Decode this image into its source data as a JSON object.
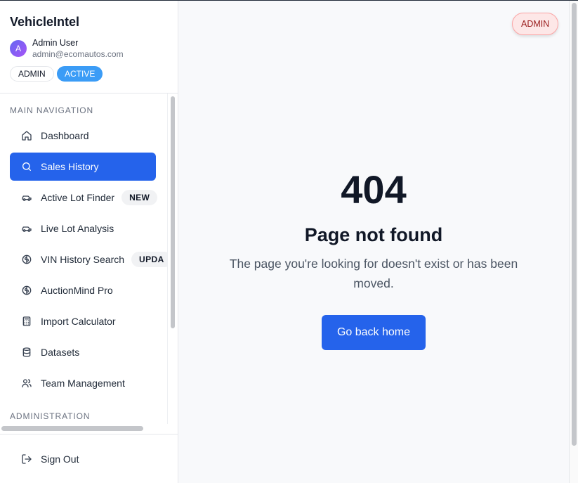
{
  "app": {
    "name": "VehicleIntel"
  },
  "user": {
    "initial": "A",
    "name": "Admin User",
    "email": "admin@ecomautos.com",
    "role_badge": "ADMIN",
    "status_badge": "ACTIVE"
  },
  "nav": {
    "section_main": "MAIN NAVIGATION",
    "section_admin": "ADMINISTRATION",
    "items": [
      {
        "label": "Dashboard",
        "icon": "home-icon"
      },
      {
        "label": "Sales History",
        "icon": "search-icon",
        "active": true
      },
      {
        "label": "Active Lot Finder",
        "icon": "car-icon",
        "tag": "NEW"
      },
      {
        "label": "Live Lot Analysis",
        "icon": "car-icon"
      },
      {
        "label": "VIN History Search",
        "icon": "brain-icon",
        "tag": "UPDA"
      },
      {
        "label": "AuctionMind Pro",
        "icon": "brain-icon"
      },
      {
        "label": "Import Calculator",
        "icon": "calculator-icon"
      },
      {
        "label": "Datasets",
        "icon": "database-icon"
      },
      {
        "label": "Team Management",
        "icon": "users-icon"
      }
    ],
    "sign_out": "Sign Out"
  },
  "header": {
    "admin_badge": "ADMIN"
  },
  "error": {
    "code": "404",
    "title": "Page not found",
    "message": "The page you're looking for doesn't exist or has been moved.",
    "button": "Go back home"
  },
  "colors": {
    "primary": "#2563eb",
    "active_badge": "#3b9cf6",
    "admin_badge_bg": "#fde7e7",
    "admin_badge_text": "#991b1b"
  }
}
